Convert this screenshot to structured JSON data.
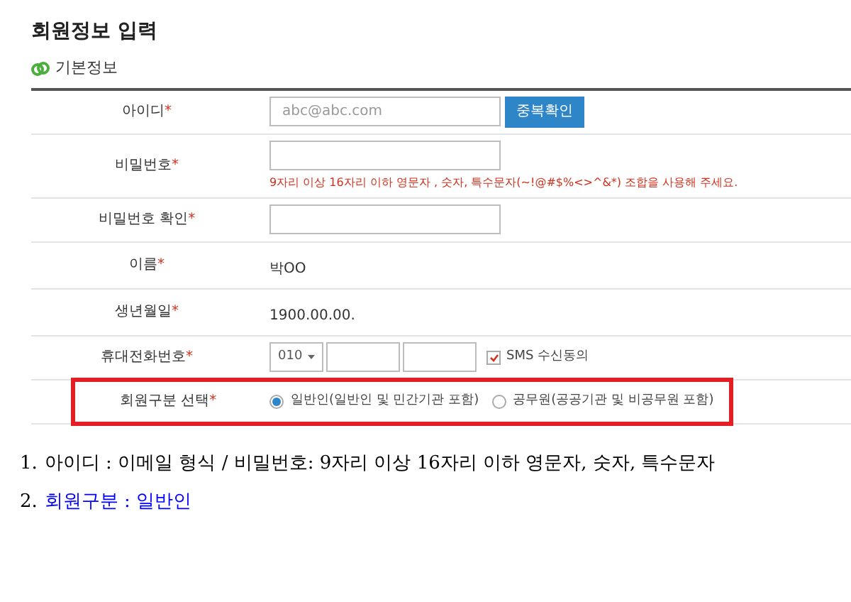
{
  "title": "회원정보 입력",
  "section": {
    "title": "기본정보"
  },
  "rows": [
    {
      "kind": "input",
      "label": "아이디",
      "mark": "*",
      "highlighted": false,
      "placeholder": "abc@abc.com",
      "button": "중복확인"
    },
    {
      "kind": "password",
      "label": "비밀번호",
      "mark": "*",
      "highlighted": false,
      "hint": "9자리 이상 16자리 이하 영문자 , 숫자, 특수문자(~!@#$%<>^&*) 조합을 사용해 주세요."
    },
    {
      "kind": "input",
      "label": "비밀번호 확인",
      "mark": "*",
      "highlighted": false
    },
    {
      "kind": "text",
      "label": "이름",
      "mark": "*",
      "highlighted": false,
      "value": "박OO"
    },
    {
      "kind": "text",
      "label": "생년월일",
      "mark": "*",
      "highlighted": false,
      "value": "1900.00.00."
    },
    {
      "kind": "phone",
      "label": "휴대전화번호",
      "mark": "*",
      "highlighted": false,
      "prefix": "010",
      "checkbox": {
        "label": "SMS 수신동의",
        "checked": true
      }
    },
    {
      "kind": "radio",
      "label": "회원구분 선택",
      "mark": "*",
      "highlighted": true,
      "options": [
        {
          "label": "일반인(일반인 및 민간기관 포함)",
          "selected": true
        },
        {
          "label": "공무원(공공기관 및 비공무원 포함)",
          "selected": false
        }
      ]
    }
  ],
  "notes": [
    {
      "number": "1.",
      "text": "아이디 : 이메일 형식 / 비밀번호: 9자리 이상 16자리 이하 영문자, 숫자, 특수문자",
      "color": "#000000"
    },
    {
      "number": "2.",
      "text": "회원구분 : 일반인",
      "color": "#0000ff"
    }
  ]
}
